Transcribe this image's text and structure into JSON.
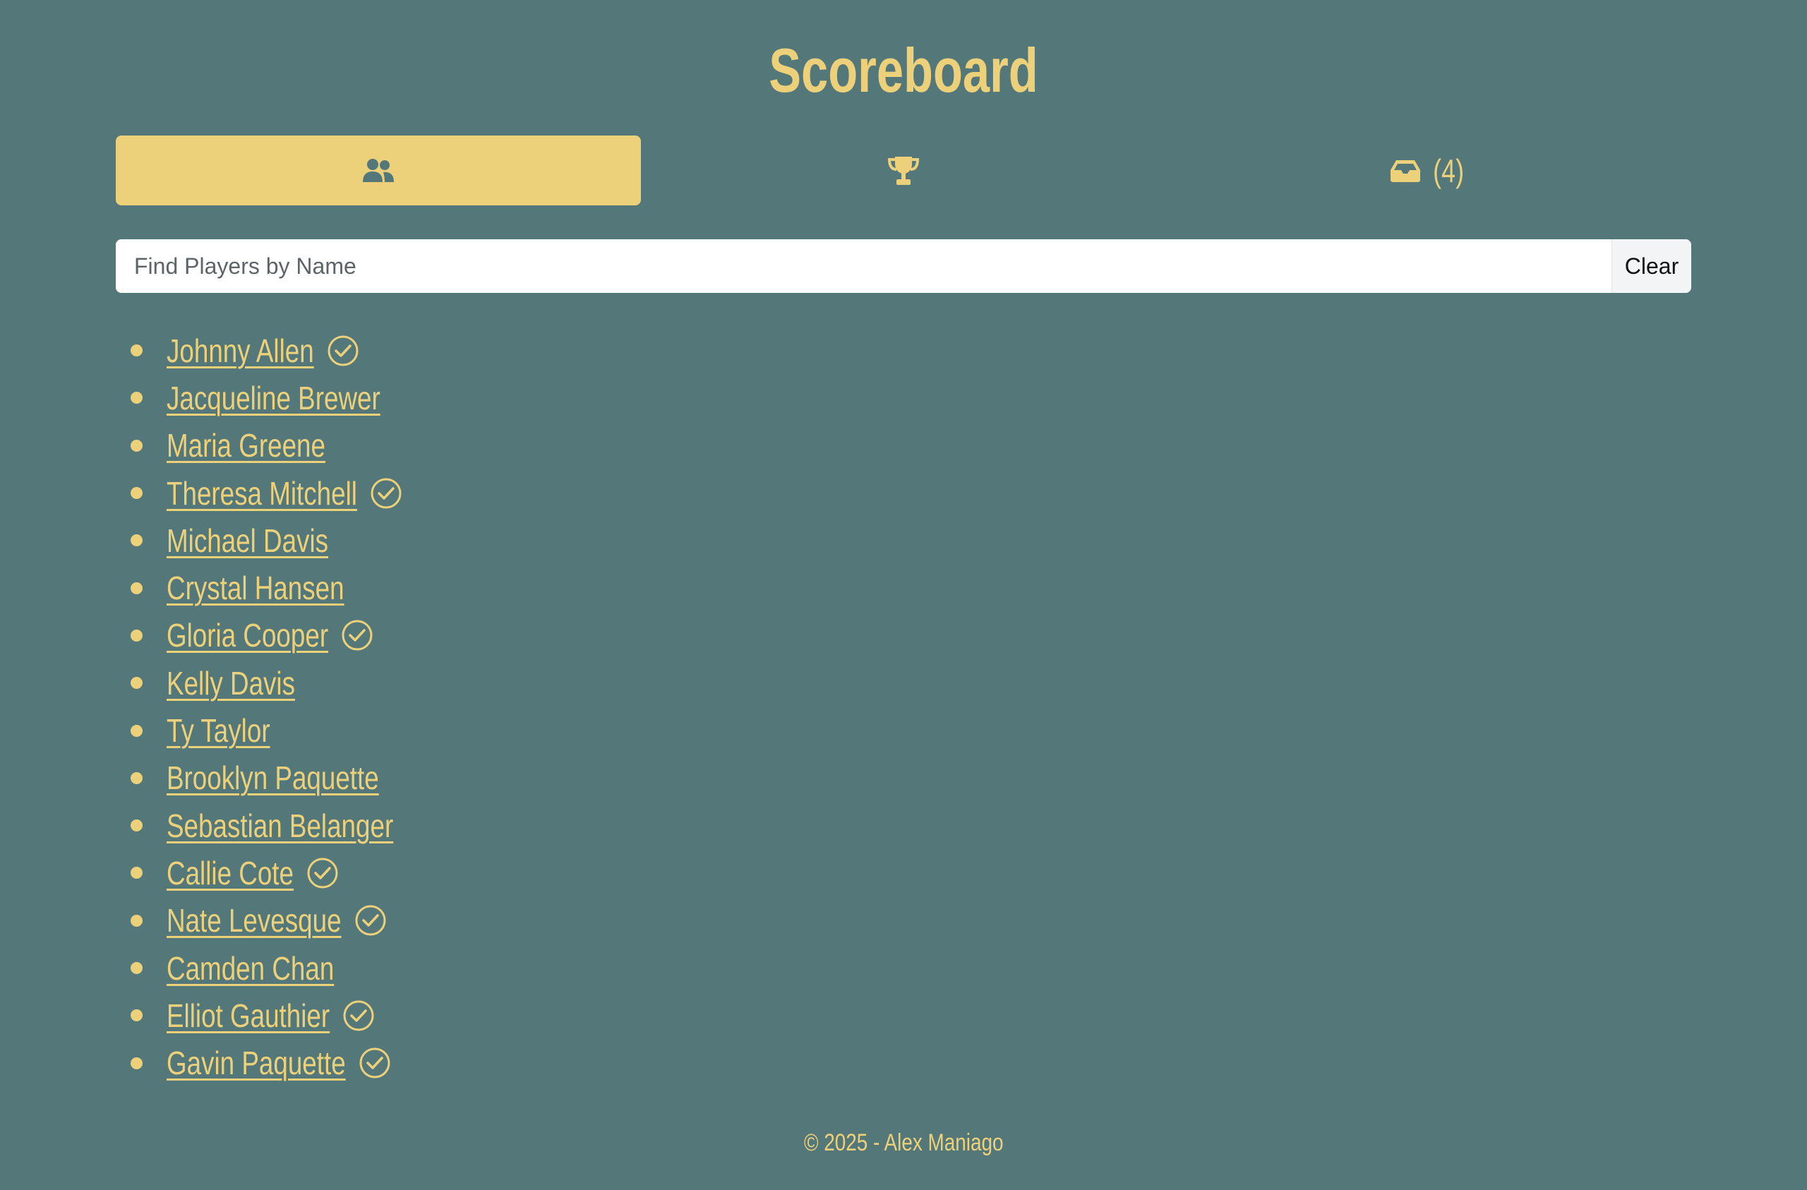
{
  "header": {
    "title": "Scoreboard"
  },
  "tabs": [
    {
      "name": "players",
      "icon": "users-icon",
      "active": true
    },
    {
      "name": "leaderboard",
      "icon": "trophy-icon",
      "active": false
    },
    {
      "name": "inbox",
      "icon": "inbox-icon",
      "count_label": "(4)",
      "active": false
    }
  ],
  "search": {
    "placeholder": "Find Players by Name",
    "value": "",
    "clear_label": "Clear"
  },
  "players": [
    {
      "name": "Johnny Allen",
      "checked": true
    },
    {
      "name": "Jacqueline Brewer",
      "checked": false
    },
    {
      "name": "Maria Greene",
      "checked": false
    },
    {
      "name": "Theresa Mitchell",
      "checked": true
    },
    {
      "name": "Michael Davis",
      "checked": false
    },
    {
      "name": "Crystal Hansen",
      "checked": false
    },
    {
      "name": "Gloria Cooper",
      "checked": true
    },
    {
      "name": "Kelly Davis",
      "checked": false
    },
    {
      "name": "Ty Taylor",
      "checked": false
    },
    {
      "name": "Brooklyn Paquette",
      "checked": false
    },
    {
      "name": "Sebastian Belanger",
      "checked": false
    },
    {
      "name": "Callie Cote",
      "checked": true
    },
    {
      "name": "Nate Levesque",
      "checked": true
    },
    {
      "name": "Camden Chan",
      "checked": false
    },
    {
      "name": "Elliot Gauthier",
      "checked": true
    },
    {
      "name": "Gavin Paquette",
      "checked": true
    }
  ],
  "footer": {
    "text": "© 2025 - Alex Maniago"
  },
  "colors": {
    "background": "#54777a",
    "accent": "#edd17a"
  }
}
